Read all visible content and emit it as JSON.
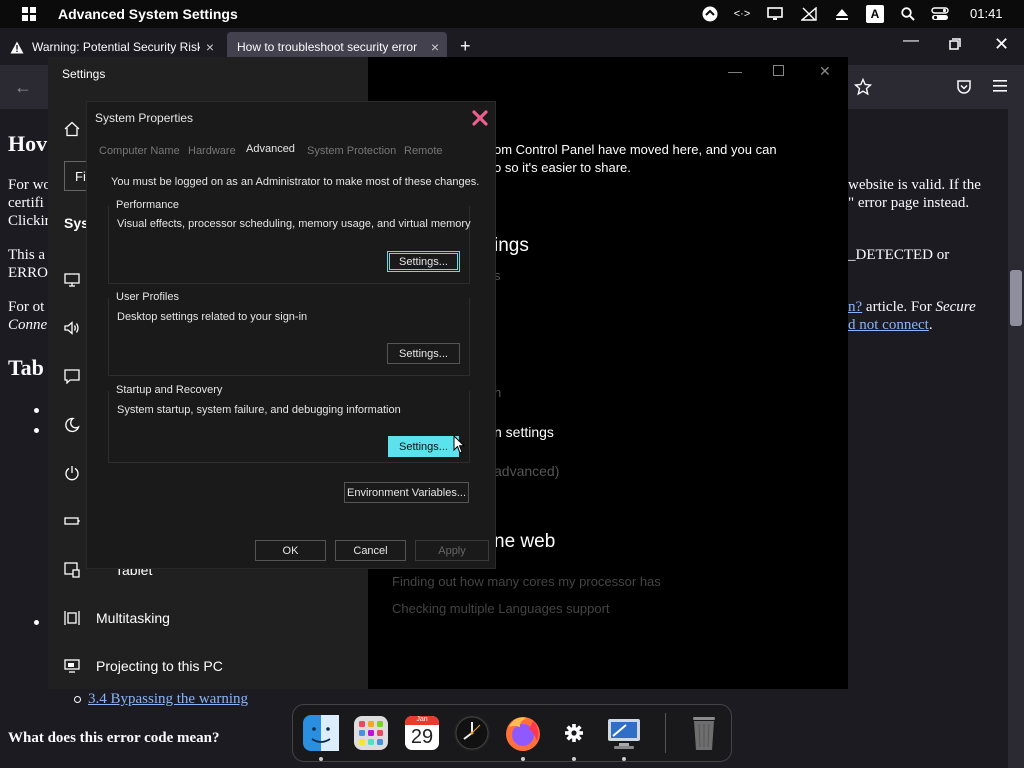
{
  "topbar": {
    "title": "Advanced System Settings",
    "clock": "01:41",
    "keyboard_indicator": "A"
  },
  "tabs": [
    {
      "label": "Warning: Potential Security Risk",
      "icon": "warning-icon"
    },
    {
      "label": "How to troubleshoot security error",
      "icon": ""
    }
  ],
  "page": {
    "heading_partial": "Hov",
    "para1_left": [
      "For wo",
      "certifi",
      "Clickir"
    ],
    "para1_right": [
      "website is valid. If the",
      "\" error page instead."
    ],
    "para2_left": [
      "This a",
      "ERRO"
    ],
    "para2_right": "_DETECTED or",
    "para3_left": [
      "For ot",
      "Conne"
    ],
    "para3_right_link1": "n?",
    "para3_right_text": " article. For ",
    "para3_right_italic": "Secure",
    "para3_right_link2": "d not connect",
    "tab_heading_partial": "Tab",
    "toc_link": "3.4 Bypassing the warning",
    "bottom_heading": "What does this error code mean?"
  },
  "settings": {
    "window_title": "Settings",
    "search_partial": "Fi",
    "section_partial": "Sys",
    "nav": [
      {
        "label": "Tablet",
        "icon": "tablet-icon"
      },
      {
        "label": "Multitasking",
        "icon": "multitasking-icon"
      },
      {
        "label": "Projecting to this PC",
        "icon": "projecting-icon"
      }
    ],
    "right": {
      "line1": "om Control Panel have moved here, and you can",
      "line2": "o so it's easier to share.",
      "heading1": "ings",
      "dim1": "s",
      "dim2": "n",
      "link1": "n settings",
      "dim3": "advanced)",
      "heading2": "ne web",
      "help1": "Finding out how many cores my processor has",
      "help2": "Checking multiple Languages support"
    }
  },
  "sysprop": {
    "title": "System Properties",
    "tabs": [
      "Computer Name",
      "Hardware",
      "Advanced",
      "System Protection",
      "Remote"
    ],
    "active_tab": "Advanced",
    "admin_note": "You must be logged on as an Administrator to make most of these changes.",
    "performance": {
      "label": "Performance",
      "desc": "Visual effects, processor scheduling, memory usage, and virtual memory",
      "button": "Settings..."
    },
    "user_profiles": {
      "label": "User Profiles",
      "desc": "Desktop settings related to your sign-in",
      "button": "Settings..."
    },
    "startup": {
      "label": "Startup and Recovery",
      "desc": "System startup, system failure, and debugging information",
      "button": "Settings..."
    },
    "env_button": "Environment Variables...",
    "ok": "OK",
    "cancel": "Cancel",
    "apply": "Apply"
  },
  "dock": {
    "calendar_month": "Jan",
    "calendar_day": "29",
    "apps": [
      "finder-icon",
      "launchpad-icon",
      "calendar-icon",
      "clock-icon",
      "firefox-icon",
      "settings-gear-icon",
      "remote-desktop-icon",
      "trash-icon"
    ]
  },
  "colors": {
    "hover_button": "#5de1ec",
    "close_button": "#e8618c",
    "link": "#8ab4f8"
  }
}
